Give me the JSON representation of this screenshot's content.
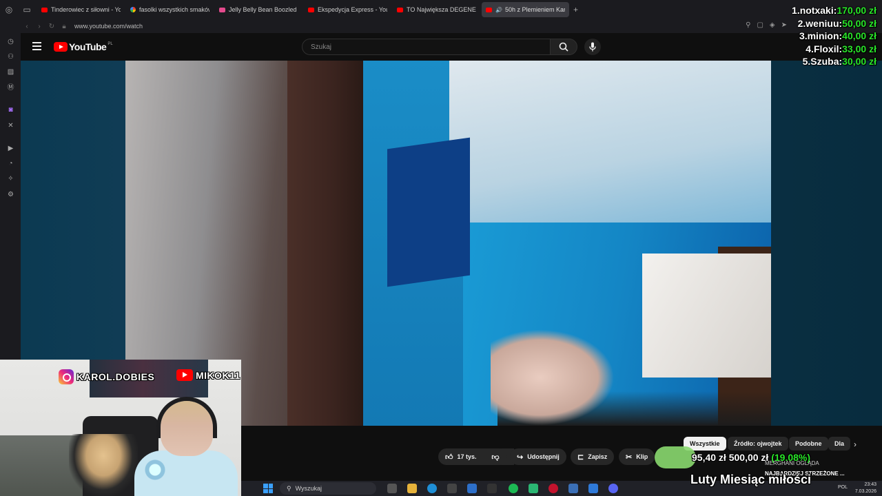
{
  "browser": {
    "tabs": [
      {
        "label": "Tinderowiec z siłowni - Yo",
        "fav": "youtube-icon"
      },
      {
        "label": "fasolki wszystkich smaków",
        "fav": "google-icon"
      },
      {
        "label": "Jelly Belly Bean Boozled S",
        "fav": "jelly-icon"
      },
      {
        "label": "Ekspedycja Express - You",
        "fav": "youtube-icon"
      },
      {
        "label": "TO Największa DEGENERA",
        "fav": "youtube-icon"
      },
      {
        "label": "50h z Plemieniem Kani",
        "fav": "youtube-icon"
      }
    ],
    "new_tab": "+",
    "url": "www.youtube.com/watch"
  },
  "youtube": {
    "logo_text": "YouTube",
    "region": "PL",
    "search_placeholder": "Szukaj"
  },
  "donations": [
    {
      "rank_name": "1.notxaki:",
      "amount": "170,00 zł"
    },
    {
      "rank_name": "2.weniuu:",
      "amount": "50,00 zł"
    },
    {
      "rank_name": "3.minion:",
      "amount": "40,00 zł"
    },
    {
      "rank_name": "4.Floxil:",
      "amount": "33,00 zł"
    },
    {
      "rank_name": "5.Szuba:",
      "amount": "30,00 zł"
    }
  ],
  "cam": {
    "instagram": "KAROL.DOBIES",
    "youtube": "MIKOK11"
  },
  "actions": {
    "likes": "17 tys.",
    "share": "Udostępnij",
    "save": "Zapisz",
    "clip": "Klip"
  },
  "chips": [
    "Wszystkie",
    "Źródło: ojwojtek",
    "Podobne",
    "Dla"
  ],
  "goal": {
    "current": "95,40 zł",
    "target": "500,00 zł",
    "percent": "(19.08%)",
    "fraction": 0.1908
  },
  "ticker": {
    "line1": "MERGHANI OGLĄDA",
    "line2": "NAJBARDZIEJ STRZEŻONE ..."
  },
  "month_title": "Luty Miesiąc miłości",
  "taskbar": {
    "search": "Wyszukaj",
    "lang": "POL",
    "time": "23:43",
    "date": "7.03.2026"
  },
  "colors": {
    "youtube_red": "#ff0000",
    "donation_green": "#29e629",
    "goal_fill": "#8ad96f"
  }
}
